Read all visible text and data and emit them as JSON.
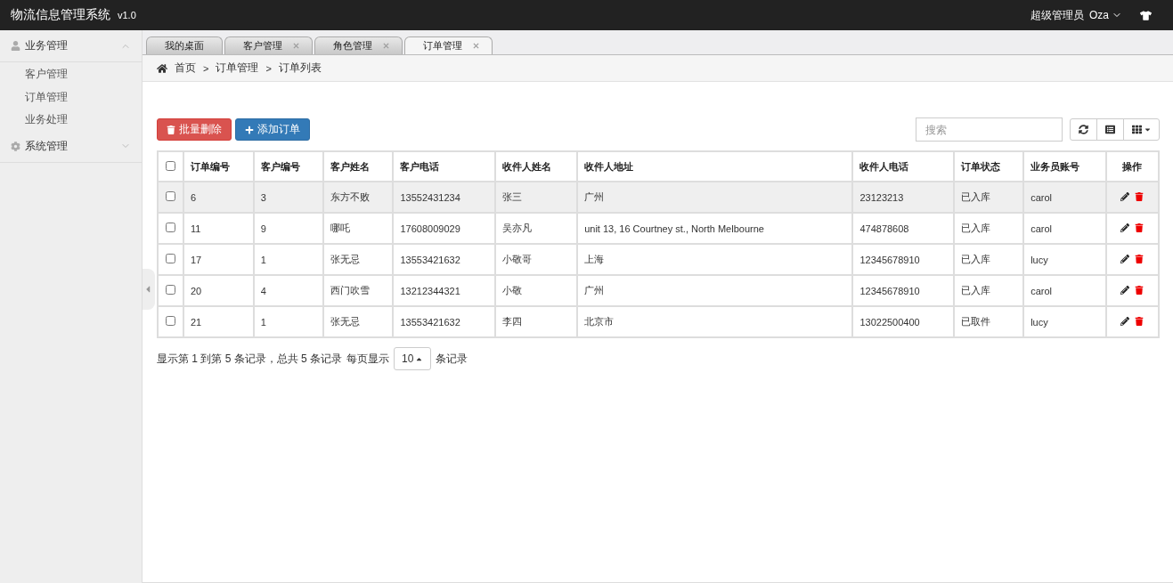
{
  "app": {
    "title": "物流信息管理系统",
    "version": "v1.0",
    "user_role": "超级管理员",
    "user_name": "Oza"
  },
  "sidebar": {
    "groups": [
      {
        "label": "业务管理",
        "expanded": true,
        "children": [
          {
            "label": "客户管理"
          },
          {
            "label": "订单管理"
          },
          {
            "label": "业务处理"
          }
        ]
      },
      {
        "label": "系统管理",
        "expanded": false
      }
    ]
  },
  "tabs": [
    {
      "label": "我的桌面",
      "closable": false,
      "selected": false
    },
    {
      "label": "客户管理",
      "closable": true,
      "selected": false
    },
    {
      "label": "角色管理",
      "closable": true,
      "selected": false
    },
    {
      "label": "订单管理",
      "closable": true,
      "selected": true
    }
  ],
  "breadcrumb": {
    "separator": ">",
    "items": [
      "首页",
      "订单管理",
      "订单列表"
    ]
  },
  "toolbar": {
    "delete_button": "批量删除",
    "add_button": "添加订单",
    "search": {
      "placeholder": "搜索"
    }
  },
  "table": {
    "select_all": {
      "checked": false
    },
    "columns": [
      "订单编号",
      "客户编号",
      "客户姓名",
      "客户电话",
      "收件人姓名",
      "收件人地址",
      "收件人电话",
      "订单状态",
      "业务员账号",
      "操作"
    ],
    "rows": [
      {
        "checked": false,
        "hovered": true,
        "cells": [
          "6",
          "3",
          "东方不败",
          "13552431234",
          "张三",
          "广州",
          "23123213",
          "已入库",
          "carol"
        ]
      },
      {
        "checked": false,
        "hovered": false,
        "cells": [
          "11",
          "9",
          "哪吒",
          "17608009029",
          "吴亦凡",
          "unit 13, 16 Courtney st., North Melbourne",
          "474878608",
          "已入库",
          "carol"
        ]
      },
      {
        "checked": false,
        "hovered": false,
        "cells": [
          "17",
          "1",
          "张无忌",
          "13553421632",
          "小敬哥",
          "上海",
          "12345678910",
          "已入库",
          "lucy"
        ]
      },
      {
        "checked": false,
        "hovered": false,
        "cells": [
          "20",
          "4",
          "西门吹雪",
          "13212344321",
          "小敬",
          "广州",
          "12345678910",
          "已入库",
          "carol"
        ]
      },
      {
        "checked": false,
        "hovered": false,
        "cells": [
          "21",
          "1",
          "张无忌",
          "13553421632",
          "李四",
          "北京市",
          "13022500400",
          "已取件",
          "lucy"
        ]
      }
    ]
  },
  "pagination": {
    "summary": "显示第 1 到第 5 条记录，总共 5 条记录",
    "per_page_label": "每页显示",
    "per_page": "10",
    "per_page_suffix": "条记录"
  }
}
